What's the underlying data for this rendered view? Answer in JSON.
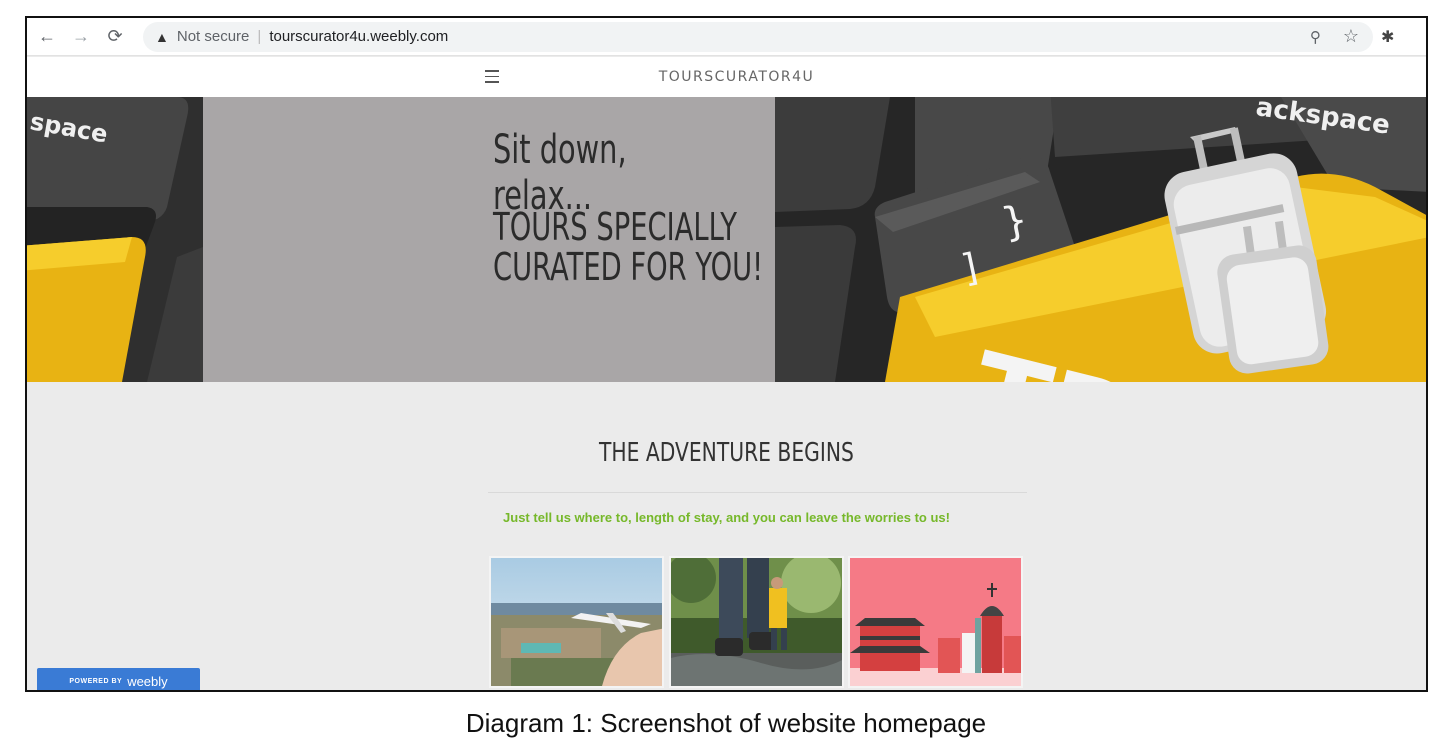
{
  "browser": {
    "warning_icon": "warning-triangle-icon",
    "security_text": "Not secure",
    "url": "tourscurator4u.weebly.com",
    "back_icon": "arrow-left-icon",
    "forward_icon": "arrow-right-icon",
    "reload_icon": "reload-icon",
    "zoom_icon": "zoom-icon",
    "bookmark_icon": "star-icon",
    "extension_icon": "puzzle-icon"
  },
  "site": {
    "title": "TOURSCURATOR4U",
    "menu_icon": "hamburger-menu-icon"
  },
  "hero": {
    "line1": "Sit down, relax...",
    "line2": "TOURS SPECIALLY CURATED FOR YOU!",
    "key_left_text": "space",
    "key_right_text": "ackspace",
    "key_bracket_1": "}",
    "key_bracket_2": "]",
    "key_travel_text": "TR"
  },
  "content": {
    "heading": "THE ADVENTURE BEGINS",
    "tagline": "Just tell us where to, length of stay, and you can leave the worries to us!"
  },
  "thumbnails": [
    {
      "name": "plane-over-resort"
    },
    {
      "name": "hikers-on-trail"
    },
    {
      "name": "city-illustration"
    }
  ],
  "badge": {
    "powered_by": "POWERED BY",
    "brand": "weebly"
  },
  "caption": "Diagram 1: Screenshot of website homepage",
  "colors": {
    "tagline_green": "#76b82a",
    "badge_blue": "#3a7bd5",
    "hero_grey": "#a9a6a7",
    "key_yellow": "#f2c21b"
  }
}
